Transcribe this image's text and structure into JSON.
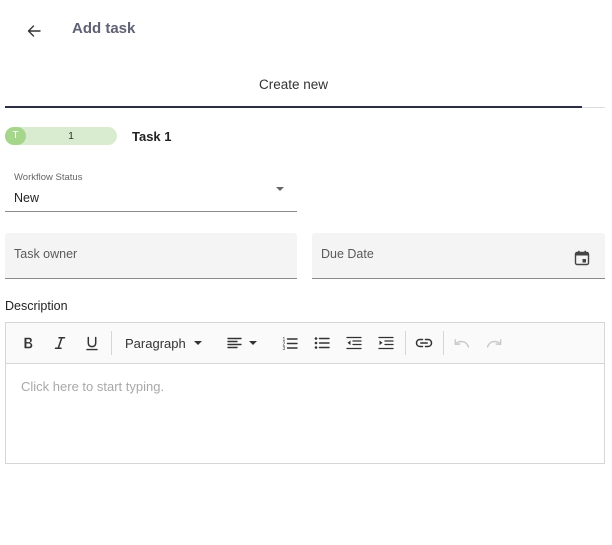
{
  "header": {
    "back_icon": "arrow-left-icon",
    "title": "Add task"
  },
  "tabs": [
    {
      "label": "Create new",
      "active": true
    }
  ],
  "task": {
    "badge_letter": "T",
    "badge_number": "1",
    "badge_color": "#a6d68c",
    "badge_bg": "#d9ecd0",
    "name": "Task 1"
  },
  "form": {
    "workflow_status": {
      "label": "Workflow Status",
      "value": "New"
    },
    "task_owner": {
      "placeholder": "Task owner",
      "value": ""
    },
    "due_date": {
      "placeholder": "Due Date",
      "value": "",
      "icon": "calendar-icon"
    },
    "description_label": "Description"
  },
  "editor": {
    "paragraph_style": "Paragraph",
    "placeholder": "Click here to start typing.",
    "toolbar_icons": [
      "bold-icon",
      "italic-icon",
      "underline-icon",
      "align-left-icon",
      "numbered-list-icon",
      "bulleted-list-icon",
      "outdent-icon",
      "indent-icon",
      "link-icon",
      "undo-icon",
      "redo-icon"
    ]
  },
  "colors": {
    "accent": "#2b2f45",
    "title": "#5f6175"
  }
}
